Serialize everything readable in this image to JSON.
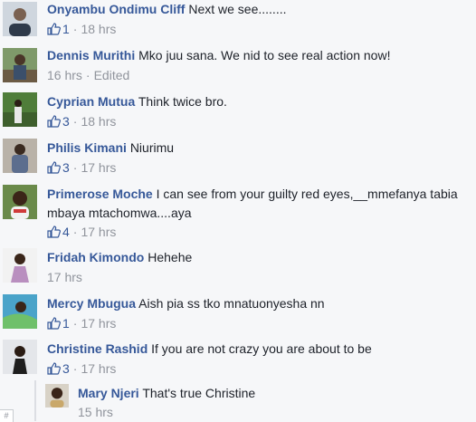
{
  "comments": [
    {
      "name": "Onyambu Ondimu Cliff",
      "text": "Next we see........",
      "likes": "1",
      "time": "18 hrs",
      "edited": ""
    },
    {
      "name": "Dennis Murithi",
      "text": "Mko juu sana. We nid to see real action now!",
      "likes": "",
      "time": "16 hrs",
      "edited": "Edited"
    },
    {
      "name": "Cyprian Mutua",
      "text": "Think twice bro.",
      "likes": "3",
      "time": "18 hrs",
      "edited": ""
    },
    {
      "name": "Philis Kimani",
      "text": "Niurimu",
      "likes": "3",
      "time": "17 hrs",
      "edited": ""
    },
    {
      "name": "Primerose Moche",
      "text": "I can see from your guilty red eyes,__mmefanya tabia mbaya mtachomwa....aya",
      "likes": "4",
      "time": "17 hrs",
      "edited": ""
    },
    {
      "name": "Fridah Kimondo",
      "text": "Hehehe",
      "likes": "",
      "time": "17 hrs",
      "edited": ""
    },
    {
      "name": "Mercy Mbugua",
      "text": "Aish pia ss tko mnatuonyesha nn",
      "likes": "1",
      "time": "17 hrs",
      "edited": ""
    },
    {
      "name": "Christine Rashid",
      "text": "If you are not crazy you are about to be",
      "likes": "3",
      "time": "17 hrs",
      "edited": ""
    }
  ],
  "reply": {
    "name": "Mary Njeri",
    "text": "That's true Christine",
    "time": "15 hrs"
  },
  "footer_glyph": "#",
  "colors": {
    "link": "#365899",
    "meta": "#90949c",
    "background": "#f6f7f9"
  }
}
